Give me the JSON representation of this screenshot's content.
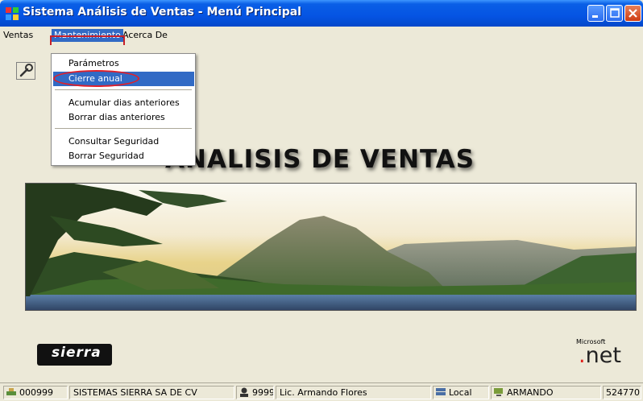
{
  "window": {
    "title": "Sistema Análisis de Ventas - Menú Principal"
  },
  "menubar": {
    "items": [
      {
        "label": "Ventas"
      },
      {
        "label": "Mantenimiento"
      },
      {
        "label": "Acerca De"
      }
    ]
  },
  "dropdown": {
    "items": [
      {
        "label": "Parámetros"
      },
      {
        "label": "Cierre anual"
      },
      {
        "label": "Acumular dias anteriores"
      },
      {
        "label": "Borrar dias anteriores"
      },
      {
        "label": "Consultar Seguridad"
      },
      {
        "label": "Borrar Seguridad"
      }
    ]
  },
  "main": {
    "heading": "ANALISIS DE VENTAS",
    "sierra_logo": "sierra",
    "ms_small": "Microsoft",
    "net_logo": "net"
  },
  "statusbar": {
    "company_code": "000999",
    "company_name": "SISTEMAS SIERRA SA DE CV",
    "user_code": "9999",
    "user_name": "Lic. Armando Flores",
    "server": "Local",
    "machine": "ARMANDO",
    "number": "524770"
  },
  "colors": {
    "titlebar": "#0554e3",
    "menu_highlight": "#316ac5",
    "annotation": "#e0202a"
  },
  "icons": {
    "app": "app-icon",
    "tool": "wrench-icon",
    "status_company": "network-icon",
    "status_user": "user-icon",
    "status_server": "server-icon",
    "status_machine": "computer-icon"
  }
}
